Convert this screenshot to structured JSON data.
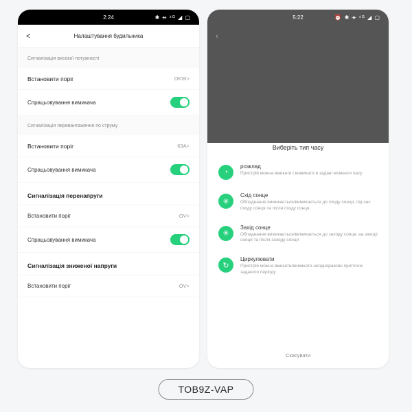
{
  "phone1": {
    "status": {
      "time": "2:24",
      "icons": "✱ ᚑ ⁴ᴳ ◢ ▢"
    },
    "header": {
      "back": "<",
      "title": "Налаштування будильника"
    },
    "s1": {
      "label": "Сигналізація високої потужності"
    },
    "r1": {
      "label": "Встановити поріг",
      "value": "OKW>"
    },
    "r2": {
      "label": "Спрацьовування вимикача"
    },
    "s2": {
      "label": "Сигналізація перевантаження по струму"
    },
    "r3": {
      "label": "Встановити поріг",
      "value": "63A>"
    },
    "r4": {
      "label": "Спрацьовування вимикача"
    },
    "h3": "Сигналізація перенапруги",
    "r5": {
      "label": "Встановити поріг",
      "value": "OV>"
    },
    "r6": {
      "label": "Спрацьовування вимикача"
    },
    "h4": "Сигналізація зниженої напруги",
    "r7": {
      "label": "Встановити поріг",
      "value": "OV>"
    }
  },
  "phone2": {
    "status": {
      "time": "5:22",
      "icons": "⏰ ✱ ᚑ ⁴ᴳ ◢ ▢"
    },
    "sheet_title": "Виберіть тип часу",
    "opts": [
      {
        "icon": "◔",
        "t1": "розклад",
        "t2": "Пристрій можна вмикати і вимикати в задані моменти часу"
      },
      {
        "icon": "✳",
        "t1": "Схід сонце",
        "t2": "Обладнання вимикається/вимикається до сходу сонця, під час сходу сонця та після сходу сонця"
      },
      {
        "icon": "✳",
        "t1": "Захід сонце",
        "t2": "Обладнання вимикається/вимикається до заходу сонця, на заході сонця та після заходу сонця"
      },
      {
        "icon": "↻",
        "t1": "Циркулювати",
        "t2": "Пристрій можна вмикати/вимикати неодноразово протягом заданого періоду"
      }
    ],
    "cancel": "Скасувати"
  },
  "badge": "TOB9Z-VAP"
}
